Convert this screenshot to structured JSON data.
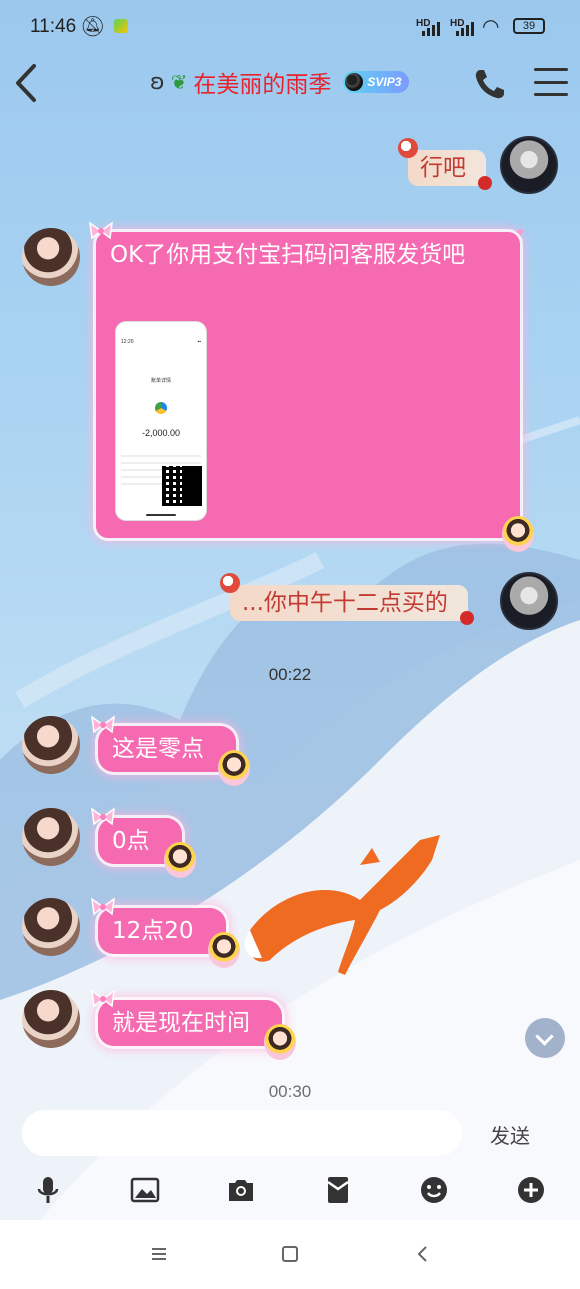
{
  "status_bar": {
    "time": "11:46",
    "battery": "39",
    "signal_1": "HD",
    "signal_2": "HD"
  },
  "header": {
    "title": "在美丽的雨季",
    "vip_badge": "SVIP3"
  },
  "messages": {
    "m1": {
      "text": "行吧"
    },
    "m2": {
      "text": "OK了你用支付宝扫码问客服发货吧"
    },
    "receipt": {
      "top_left": "12:20",
      "header": "账单详情",
      "amount": "-2,000.00"
    },
    "m3": {
      "text": "...你中午十二点买的"
    },
    "time1": "00:22",
    "m4": {
      "text": "这是零点"
    },
    "m5": {
      "text": "0点"
    },
    "m6": {
      "text": "12点20"
    },
    "m7": {
      "text": "就是现在时间"
    },
    "time2": "00:30"
  },
  "input": {
    "value": "",
    "send_label": "发送"
  },
  "colors": {
    "bubble_pink": "#f56ab0",
    "title_red": "#e8222c",
    "right_text": "#c13b33"
  }
}
